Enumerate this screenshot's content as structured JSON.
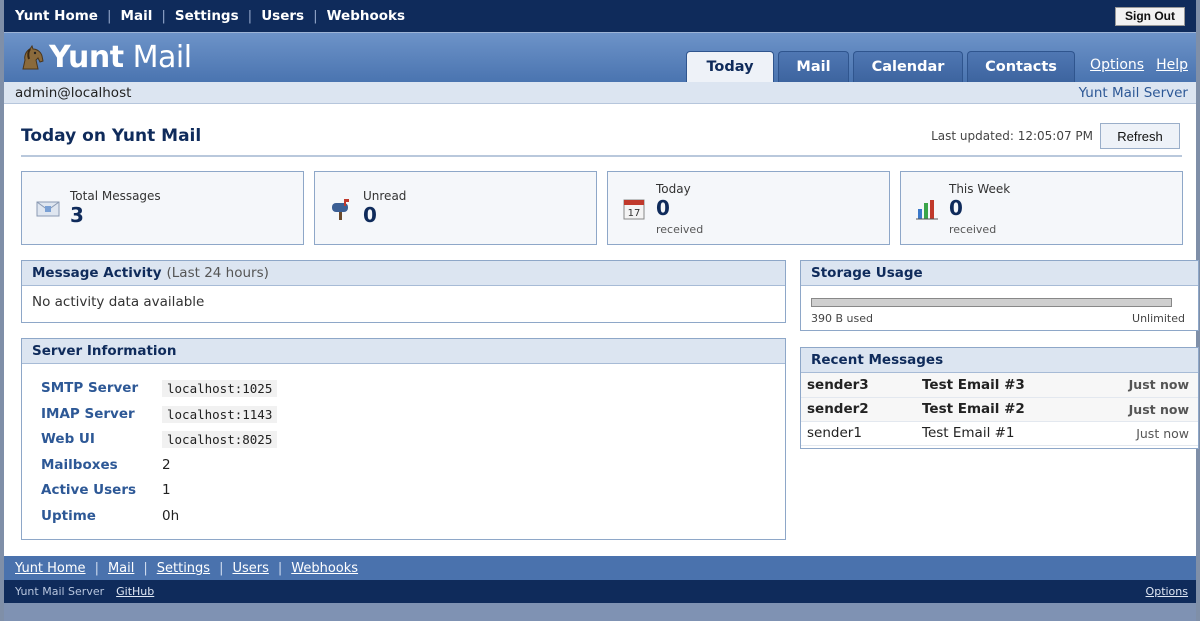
{
  "topnav": {
    "links": [
      "Yunt Home",
      "Mail",
      "Settings",
      "Users",
      "Webhooks"
    ],
    "sign_out": "Sign Out"
  },
  "header": {
    "brand_bold": "Yunt",
    "brand_light": "Mail",
    "tabs": [
      "Today",
      "Mail",
      "Calendar",
      "Contacts"
    ],
    "active_tab": "Today",
    "links": [
      "Options",
      "Help"
    ]
  },
  "userbar": {
    "user": "admin@localhost",
    "server": "Yunt Mail Server"
  },
  "page": {
    "title": "Today on Yunt Mail",
    "last_updated": "Last updated: 12:05:07 PM",
    "refresh": "Refresh"
  },
  "stats": [
    {
      "label": "Total Messages",
      "value": "3",
      "sub": "",
      "icon": "envelope-icon"
    },
    {
      "label": "Unread",
      "value": "0",
      "sub": "",
      "icon": "mailbox-icon"
    },
    {
      "label": "Today",
      "value": "0",
      "sub": "received",
      "icon": "calendar-icon"
    },
    {
      "label": "This Week",
      "value": "0",
      "sub": "received",
      "icon": "bar-chart-icon"
    }
  ],
  "activity": {
    "title": "Message Activity",
    "note": "(Last 24 hours)",
    "empty": "No activity data available"
  },
  "server_info": {
    "title": "Server Information",
    "rows": [
      {
        "key": "SMTP Server",
        "value": "localhost:1025"
      },
      {
        "key": "IMAP Server",
        "value": "localhost:1143"
      },
      {
        "key": "Web UI",
        "value": "localhost:8025"
      },
      {
        "key": "Mailboxes",
        "value": "2"
      },
      {
        "key": "Active Users",
        "value": "1"
      },
      {
        "key": "Uptime",
        "value": "0h"
      }
    ]
  },
  "storage": {
    "title": "Storage Usage",
    "used": "390 B used",
    "limit": "Unlimited",
    "fill_fraction": 0
  },
  "recent": {
    "title": "Recent Messages",
    "rows": [
      {
        "from": "sender3",
        "subject": "Test Email #3",
        "time": "Just now",
        "unread": true
      },
      {
        "from": "sender2",
        "subject": "Test Email #2",
        "time": "Just now",
        "unread": true
      },
      {
        "from": "sender1",
        "subject": "Test Email #1",
        "time": "Just now",
        "unread": false
      }
    ]
  },
  "footer": {
    "links": [
      "Yunt Home",
      "Mail",
      "Settings",
      "Users",
      "Webhooks"
    ],
    "server": "Yunt Mail Server",
    "github": "GitHub",
    "options": "Options"
  },
  "colors": {
    "navy": "#0f2b5b",
    "header_blue": "#4a74b0",
    "panel_header": "#dce5f1",
    "label_blue": "#2d5896"
  }
}
